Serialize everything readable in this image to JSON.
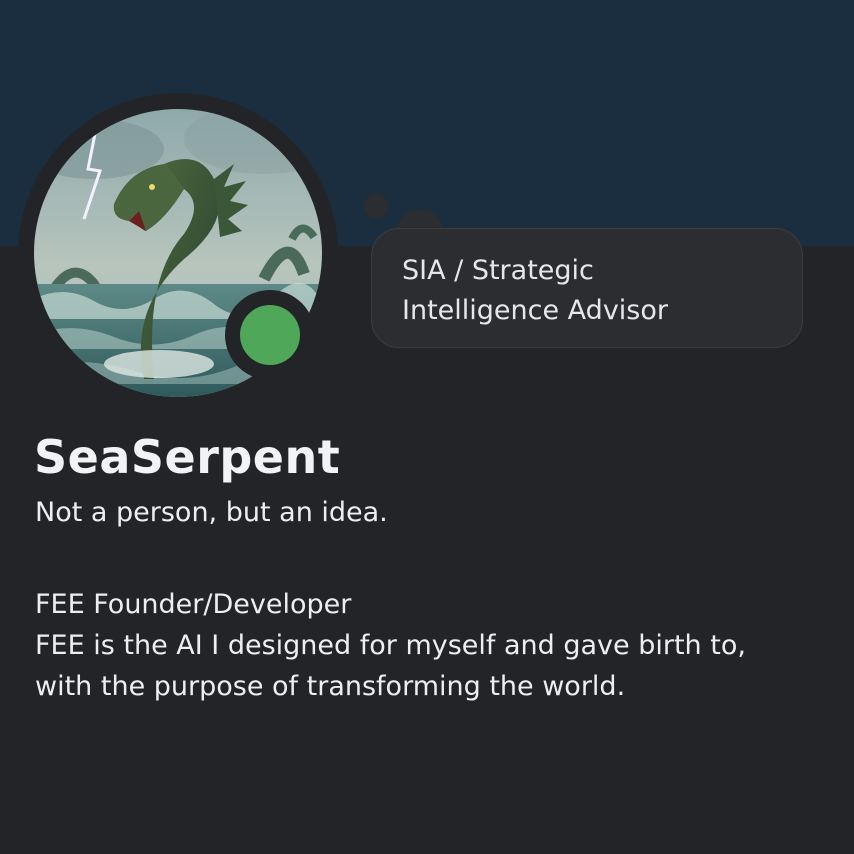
{
  "profile": {
    "display_name": "SeaSerpent",
    "tagline": "Not a person, but an idea.",
    "status": "online",
    "avatar": "sea-serpent-illustration"
  },
  "custom_status": {
    "lines": [
      "SIA / Strategic",
      "Intelligence Advisor"
    ]
  },
  "bio": {
    "lines": [
      "FEE Founder/Developer",
      "FEE is the AI I designed for myself and gave birth to,",
      "with the purpose of transforming the world."
    ]
  },
  "colors": {
    "banner": "#1a2e40",
    "background": "#232428",
    "status_online": "#4fa75a",
    "bubble": "#2b2d31",
    "bubble_border": "#3a3c42"
  }
}
